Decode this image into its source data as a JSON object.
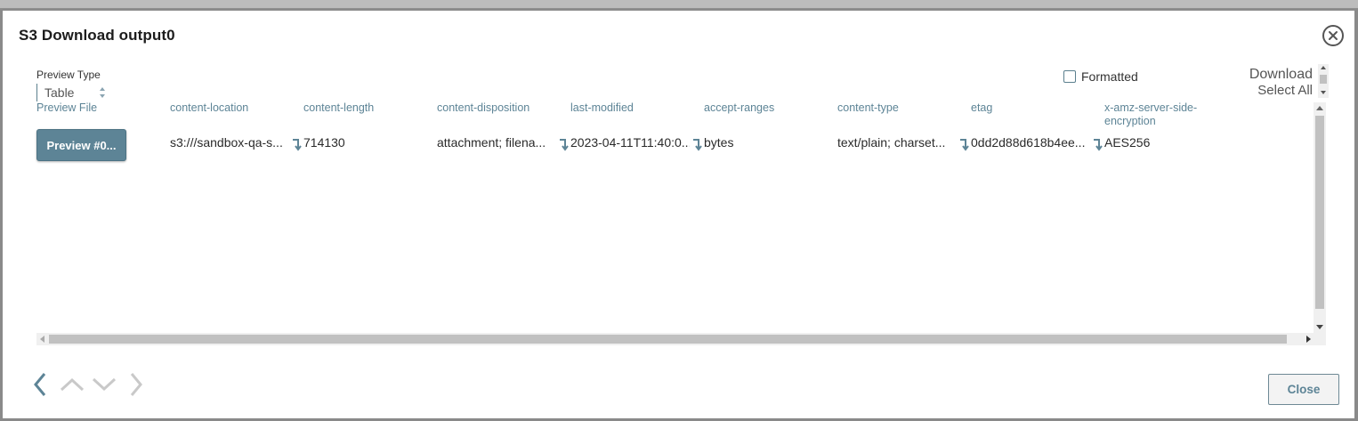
{
  "dialog": {
    "title": "S3 Download output0",
    "close_label": "Close"
  },
  "preview_type": {
    "label": "Preview Type",
    "selected": "Table"
  },
  "formatted": {
    "label": "Formatted",
    "checked": false
  },
  "download": {
    "label": "Download",
    "select_all": "Select All"
  },
  "table": {
    "columns": [
      "Preview File",
      "content-location",
      "content-length",
      "content-disposition",
      "last-modified",
      "accept-ranges",
      "content-type",
      "etag",
      "x-amz-server-side-encryption"
    ],
    "rows": [
      {
        "preview_button": "Preview #0...",
        "content-location": "s3:///sandbox-qa-s...",
        "content-length": "714130",
        "content-disposition": "attachment; filena...",
        "last-modified": "2023-04-11T11:40:0...",
        "accept-ranges": "bytes",
        "content-type": "text/plain; charset...",
        "etag": "0dd2d88d618b4ee...",
        "x-amz-server-side-encryption": "AES256"
      }
    ]
  },
  "icons": {
    "close": "close-circle-icon",
    "expand": "expand-arrow-icon",
    "prev": "chevron-left-icon",
    "up": "chevron-up-icon",
    "down": "chevron-down-icon",
    "next": "chevron-right-icon"
  },
  "colors": {
    "accent": "#5d8496",
    "background": "#ffffff",
    "scrollbar_thumb": "#c1c1c1"
  }
}
